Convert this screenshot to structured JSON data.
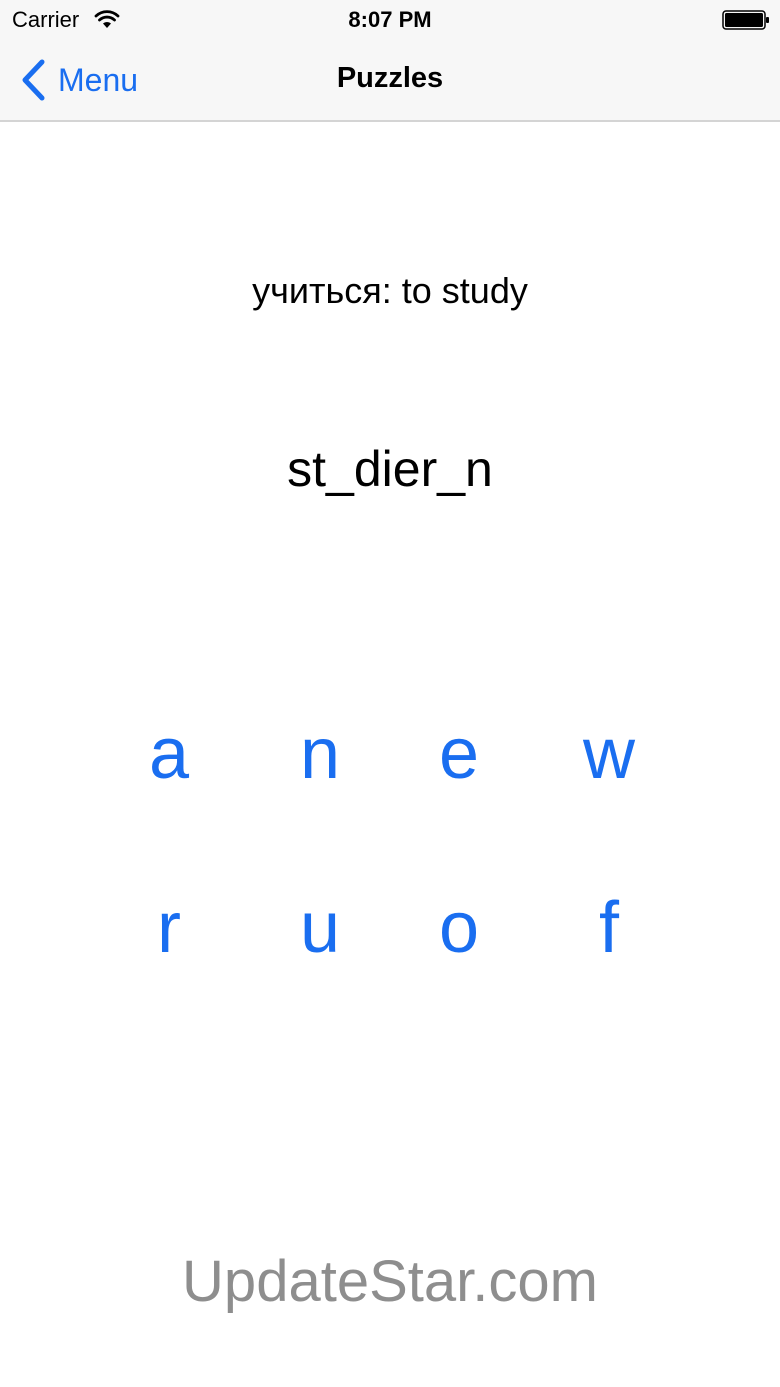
{
  "status_bar": {
    "carrier": "Carrier",
    "time": "8:07 PM",
    "icons": [
      "wifi-icon",
      "battery-icon"
    ]
  },
  "nav": {
    "back_label": "Menu",
    "title": "Puzzles",
    "accent_color": "#1a6ef0"
  },
  "puzzle": {
    "prompt": "учиться: to study",
    "word": "st_dier_n",
    "letter_rows": [
      [
        "a",
        "n",
        "e",
        "w"
      ],
      [
        "r",
        "u",
        "o",
        "f"
      ]
    ]
  },
  "watermark": "UpdateStar.com"
}
